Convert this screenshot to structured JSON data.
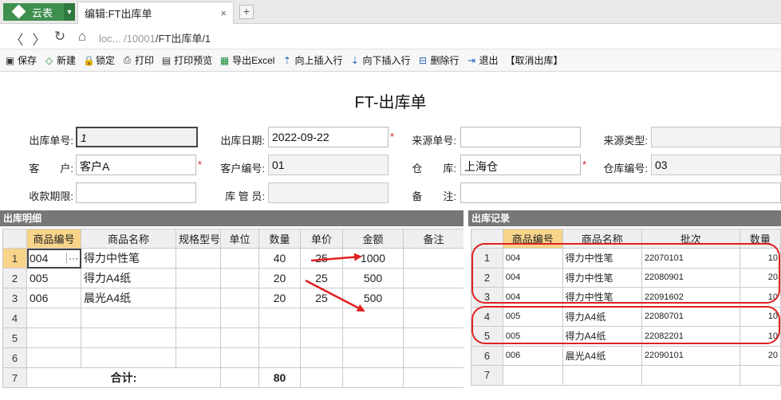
{
  "tabs": {
    "app_name": "云表",
    "doc_tab_title": "编辑:FT出库单",
    "close_glyph": "×",
    "new_tab_glyph": "+"
  },
  "nav": {
    "back": "〈",
    "forward": "〉",
    "reload": "↻",
    "home": "⌂",
    "url_host": "loc...    /10001",
    "url_path": "/FT出库单/1"
  },
  "toolbar": {
    "items": [
      {
        "label": "保存",
        "icon": "save-icon",
        "glyph": "▣"
      },
      {
        "label": "新建",
        "icon": "new-icon",
        "glyph": "◇"
      },
      {
        "label": "锁定",
        "icon": "lock-icon",
        "glyph": "🔒"
      },
      {
        "label": "打印",
        "icon": "print-icon",
        "glyph": "⎙"
      },
      {
        "label": "打印预览",
        "icon": "print-preview-icon",
        "glyph": "▤"
      },
      {
        "label": "导出Excel",
        "icon": "excel-icon",
        "glyph": "▦"
      },
      {
        "label": "向上插入行",
        "icon": "insert-above-icon",
        "glyph": "⇡"
      },
      {
        "label": "向下插入行",
        "icon": "insert-below-icon",
        "glyph": "⇣"
      },
      {
        "label": "删除行",
        "icon": "delete-row-icon",
        "glyph": "⊟"
      },
      {
        "label": "退出",
        "icon": "exit-icon",
        "glyph": "⇥"
      },
      {
        "label": "【取消出库】",
        "icon": "",
        "glyph": ""
      }
    ]
  },
  "form": {
    "title": "FT-出库单",
    "order_no_label": "出库单号:",
    "order_no": "1",
    "date_label": "出库日期:",
    "date": "2022-09-22",
    "source_no_label": "来源单号:",
    "source_no": "",
    "source_type_label": "来源类型:",
    "source_type": "",
    "customer_label": "客　　户:",
    "customer": "客户A",
    "customer_code_label": "客户编号:",
    "customer_code": "01",
    "warehouse_label": "仓　　库:",
    "warehouse": "上海仓",
    "warehouse_code_label": "仓库编号:",
    "warehouse_code": "03",
    "payment_term_label": "收款期限:",
    "payment_term": "",
    "keeper_label": "库 管 员:",
    "keeper": "",
    "remark_label": "备　　注:",
    "remark": "",
    "required_mark": "*"
  },
  "detail": {
    "title": "出库明细",
    "columns": [
      "商品编号",
      "商品名称",
      "规格型号",
      "单位",
      "数量",
      "单价",
      "金额",
      "备注"
    ],
    "rows": [
      {
        "no": "1",
        "code": "004",
        "name": "得力中性笔",
        "spec": "",
        "unit": "",
        "qty": "40",
        "price": "25",
        "amount": "1000",
        "remark": ""
      },
      {
        "no": "2",
        "code": "005",
        "name": "得力A4纸",
        "spec": "",
        "unit": "",
        "qty": "20",
        "price": "25",
        "amount": "500",
        "remark": ""
      },
      {
        "no": "3",
        "code": "006",
        "name": "晨光A4纸",
        "spec": "",
        "unit": "",
        "qty": "20",
        "price": "25",
        "amount": "500",
        "remark": ""
      },
      {
        "no": "4",
        "code": "",
        "name": "",
        "spec": "",
        "unit": "",
        "qty": "",
        "price": "",
        "amount": "",
        "remark": ""
      },
      {
        "no": "5",
        "code": "",
        "name": "",
        "spec": "",
        "unit": "",
        "qty": "",
        "price": "",
        "amount": "",
        "remark": ""
      },
      {
        "no": "6",
        "code": "",
        "name": "",
        "spec": "",
        "unit": "",
        "qty": "",
        "price": "",
        "amount": "",
        "remark": ""
      }
    ],
    "total_row_no": "7",
    "total_label": "合计:",
    "total_qty": "80",
    "ellipsis": "···"
  },
  "records": {
    "title": "出库记录",
    "columns": [
      "商品编号",
      "商品名称",
      "批次",
      "数量"
    ],
    "rows": [
      {
        "no": "1",
        "code": "004",
        "name": "得力中性笔",
        "batch": "22070101",
        "qty": "10"
      },
      {
        "no": "2",
        "code": "004",
        "name": "得力中性笔",
        "batch": "22080901",
        "qty": "20"
      },
      {
        "no": "3",
        "code": "004",
        "name": "得力中性笔",
        "batch": "22091602",
        "qty": "10"
      },
      {
        "no": "4",
        "code": "005",
        "name": "得力A4纸",
        "batch": "22080701",
        "qty": "10"
      },
      {
        "no": "5",
        "code": "005",
        "name": "得力A4纸",
        "batch": "22082201",
        "qty": "10"
      },
      {
        "no": "6",
        "code": "006",
        "name": "晨光A4纸",
        "batch": "22090101",
        "qty": "20"
      },
      {
        "no": "7",
        "code": "",
        "name": "",
        "batch": "",
        "qty": ""
      }
    ]
  },
  "colors": {
    "annotation_red": "#e02020",
    "app_green": "#3f8f4f",
    "header_highlight": "#f7d48a",
    "panel_header": "#777777"
  }
}
